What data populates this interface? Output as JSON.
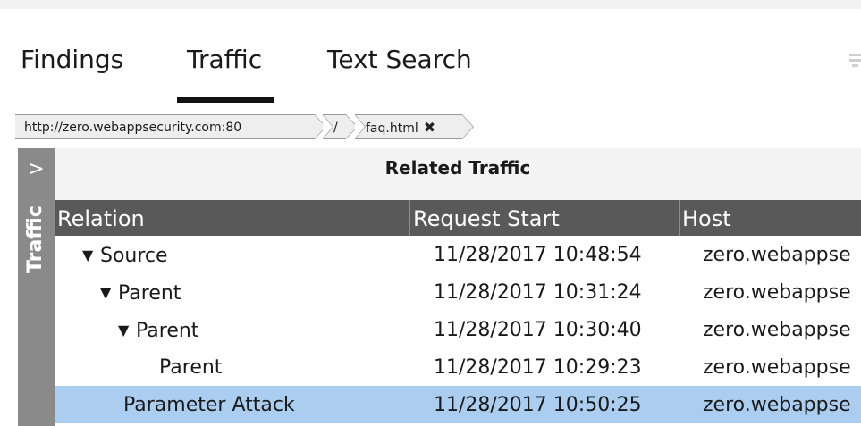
{
  "tabs": [
    {
      "label": "Findings"
    },
    {
      "label": "Traffic",
      "active": true
    },
    {
      "label": "Text Search"
    }
  ],
  "breadcrumb": [
    {
      "label": "http://zero.webappsecurity.com:80"
    },
    {
      "label": "/"
    },
    {
      "label": "faq.html",
      "closable": true,
      "close_glyph": "✖"
    }
  ],
  "side_panel": {
    "label": "Traffic",
    "expand_glyph": ">"
  },
  "grid": {
    "caption": "Related Traffic",
    "columns": [
      "Relation",
      "Request Start",
      "Host"
    ],
    "rows": [
      {
        "relation": "Source",
        "expanded": true,
        "depth": 0,
        "request_start": "11/28/2017 10:48:54",
        "host": "zero.webappse",
        "selected": false
      },
      {
        "relation": "Parent",
        "expanded": true,
        "depth": 1,
        "request_start": "11/28/2017 10:31:24",
        "host": "zero.webappse",
        "selected": false
      },
      {
        "relation": "Parent",
        "expanded": true,
        "depth": 2,
        "request_start": "11/28/2017 10:30:40",
        "host": "zero.webappse",
        "selected": false
      },
      {
        "relation": "Parent",
        "expanded": false,
        "depth": 3,
        "request_start": "11/28/2017 10:29:23",
        "host": "zero.webappse",
        "selected": false
      },
      {
        "relation": "Parameter Attack",
        "expanded": false,
        "depth": 1,
        "request_start": "11/28/2017 10:50:25",
        "host": "zero.webappse",
        "selected": true
      }
    ],
    "caret_glyph": "▼"
  },
  "colors": {
    "header_bg": "#595959",
    "side_rail_bg": "#8a8a8a",
    "selected_row_bg": "#abcdf0",
    "active_tab_underline": "#111111"
  },
  "icons": [
    "overflow-menu-icon",
    "chevron-right-icon",
    "close-icon",
    "caret-down-icon"
  ]
}
